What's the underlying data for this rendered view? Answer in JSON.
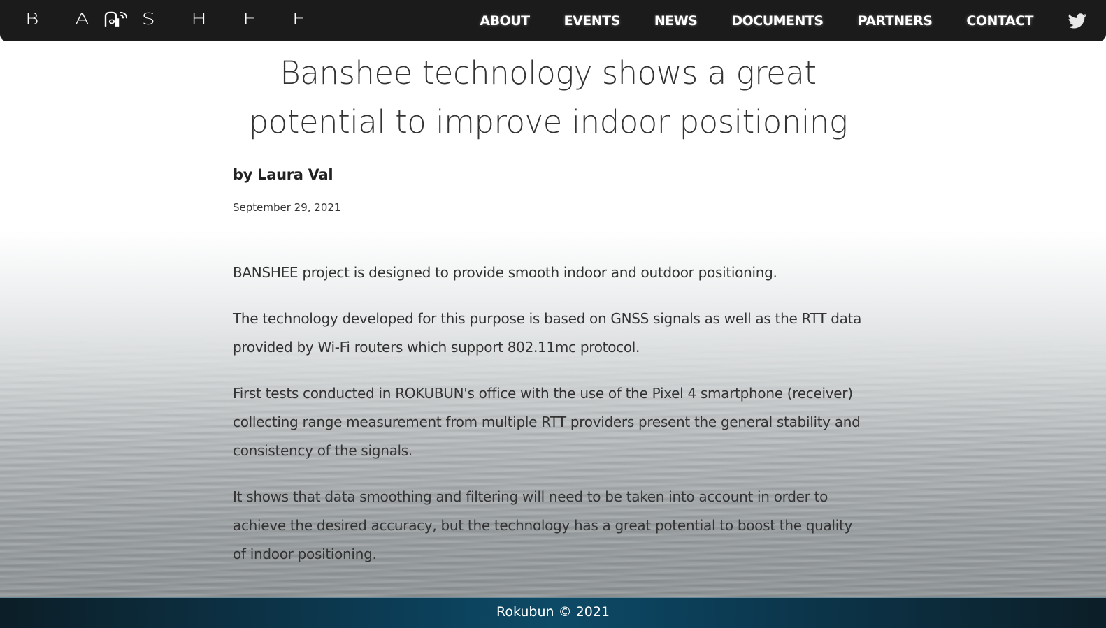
{
  "nav": {
    "logo_text": "BANSHEE",
    "logo_part1": "B A ",
    "logo_part2": "S H E E",
    "links": [
      "ABOUT",
      "EVENTS",
      "NEWS",
      "DOCUMENTS",
      "PARTNERS",
      "CONTACT"
    ],
    "twitter_icon": "twitter-icon"
  },
  "article": {
    "title": "Banshee technology shows a great potential to improve indoor positioning",
    "author": "by Laura Val",
    "date": "September 29, 2021",
    "paragraphs": [
      "BANSHEE project is designed to provide smooth indoor and outdoor positioning.",
      "The technology developed for this purpose is based on GNSS signals as well as the RTT data provided by Wi-Fi routers which support 802.11mc protocol.",
      "First tests conducted in ROKUBUN's office with the use of the Pixel 4 smartphone (receiver) collecting range measurement from multiple RTT providers present the general stability and consistency of the signals.",
      "It shows that data smoothing and filtering will need to be taken into account in order to achieve the desired accuracy, but the technology has a great potential to boost the quality of indoor positioning."
    ]
  },
  "footer": {
    "text": "Rokubun © 2021"
  },
  "colors": {
    "navbar": "#1b1b1b",
    "footer_accent": "#0d4a66",
    "text": "#333333"
  }
}
